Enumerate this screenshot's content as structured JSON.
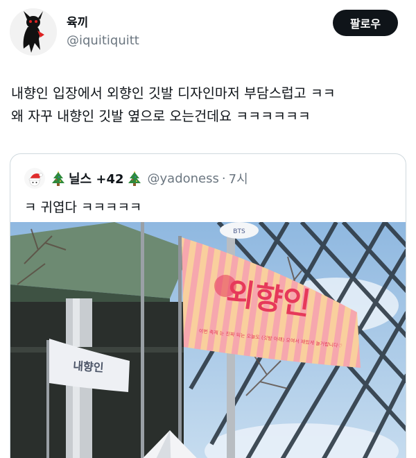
{
  "author": {
    "display_name": "육끼",
    "handle": "@iquitiquitt",
    "avatar_icon": "devil-figure-avatar"
  },
  "follow_button": {
    "label": "팔로우"
  },
  "tweet": {
    "text": "내향인 입장에서 외향인 깃발 디자인마저 부담스럽고 ㅋㅋ\n왜 자꾸 내향인 깃발 옆으로 오는건데요 ㅋㅋㅋㅋㅋㅋ"
  },
  "quote": {
    "avatar_icon": "santa-hat-avatar",
    "name": "닐스 +42",
    "handle": "@yadoness",
    "separator": "·",
    "time": "7시",
    "text": "ㅋ 귀엽다 ㅋㅋㅋㅋㅋ",
    "image": {
      "flag_big_text": "외향인",
      "flag_small_text": "이번 축제 는 진짜 되는 오늘도 (깃발 아래) 모여서 재밌게 놀거랍니다♡",
      "flag_small_label": "내향인",
      "top_banner_text": "BTS",
      "colors": {
        "sky": "#a9cbe8",
        "flag_pink": "#f6a6ad",
        "flag_peach": "#f9d29b",
        "flag_text": "#e6395a",
        "small_flag": "#eef0f4"
      }
    }
  },
  "icons": {
    "tree_left": "christmas-tree-icon",
    "tree_right": "christmas-tree-icon"
  }
}
